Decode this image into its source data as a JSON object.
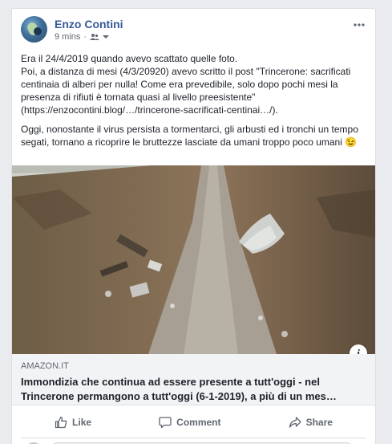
{
  "post": {
    "author": "Enzo Contini",
    "time": "9 mins",
    "paragraphs": [
      "Era il 24/4/2019 quando avevo scattato quelle foto.\nPoi, a distanza di mesi (4/3/20920) avevo scritto il post \"Trincerone: sacrificati centinaia di alberi per nulla! Come era prevedibile, solo dopo pochi mesi la presenza di rifiuti è tornata quasi al livello preesistente\"\n(https://enzocontini.blog/…/trincerone-sacrificati-centinai…/).",
      "Oggi, nonostante il virus persista a tormentarci, gli arbusti ed i tronchi un tempo segati, tornano a ricoprire le bruttezze lasciate da umani troppo poco umani 😉"
    ]
  },
  "link_preview": {
    "domain": "AMAZON.IT",
    "title": "Immondizia che continua ad essere presente a tutt'oggi - nel Trincerone permangono a tutt'oggi (6-1-2019), a più di un mes…",
    "info_glyph": "i"
  },
  "actions": {
    "like": "Like",
    "comment": "Comment",
    "share": "Share"
  },
  "icons": {
    "audience": "friends-icon",
    "more": "more-options-icon",
    "like": "thumbs-up-icon",
    "comment": "comment-bubble-icon",
    "share": "share-arrow-icon"
  },
  "colors": {
    "author_link": "#365899",
    "text": "#1d2129",
    "secondary": "#606770",
    "page_bg": "#e9ebee"
  }
}
